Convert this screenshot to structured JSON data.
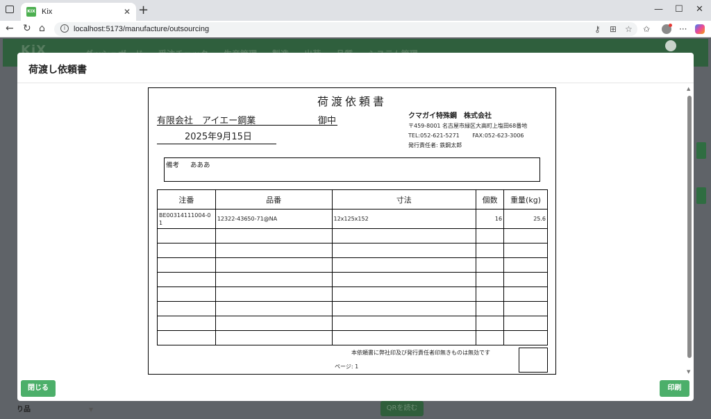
{
  "browser": {
    "tab_title": "Kix",
    "favicon_text": "KIX",
    "url": "localhost:5173/manufacture/outsourcing"
  },
  "app": {
    "logo": "KiX",
    "menu": [
      "ダッシュボード",
      "受注チェック",
      "生産管理",
      "製造",
      "出荷",
      "品質",
      "システム管理"
    ],
    "behind_label": "り品",
    "qr_button": "QRを読む"
  },
  "modal": {
    "title": "荷渡し依頼書",
    "close_button": "閉じる",
    "print_button": "印刷"
  },
  "document": {
    "title": "荷渡依頼書",
    "recipient": "有限会社　アイエー鋼業",
    "honorific": "御中",
    "date": "2025年9月15日",
    "sender": {
      "company": "クマガイ特殊鋼　株式会社",
      "address": "〒459-8001 名古屋市緑区大高町上塩田68番地",
      "tel": "TEL:052-621-5271",
      "fax": "FAX:052-623-3006",
      "person": "発行責任者: 鉄鋼太郎"
    },
    "remarks_label": "備考",
    "remarks_value": "あああ",
    "table": {
      "headers": [
        "注番",
        "品番",
        "寸法",
        "個数",
        "重量(kg)"
      ],
      "rows": [
        {
          "order_no": "BE00314111004-01",
          "part_no": "12322-43650-71@NA",
          "size": "12x125x152",
          "qty": "16",
          "weight": "25.6"
        }
      ]
    },
    "disclaimer": "本依頼書に弊社印及び発行責任者印無きものは無効です",
    "page_label": "ページ: 1"
  }
}
